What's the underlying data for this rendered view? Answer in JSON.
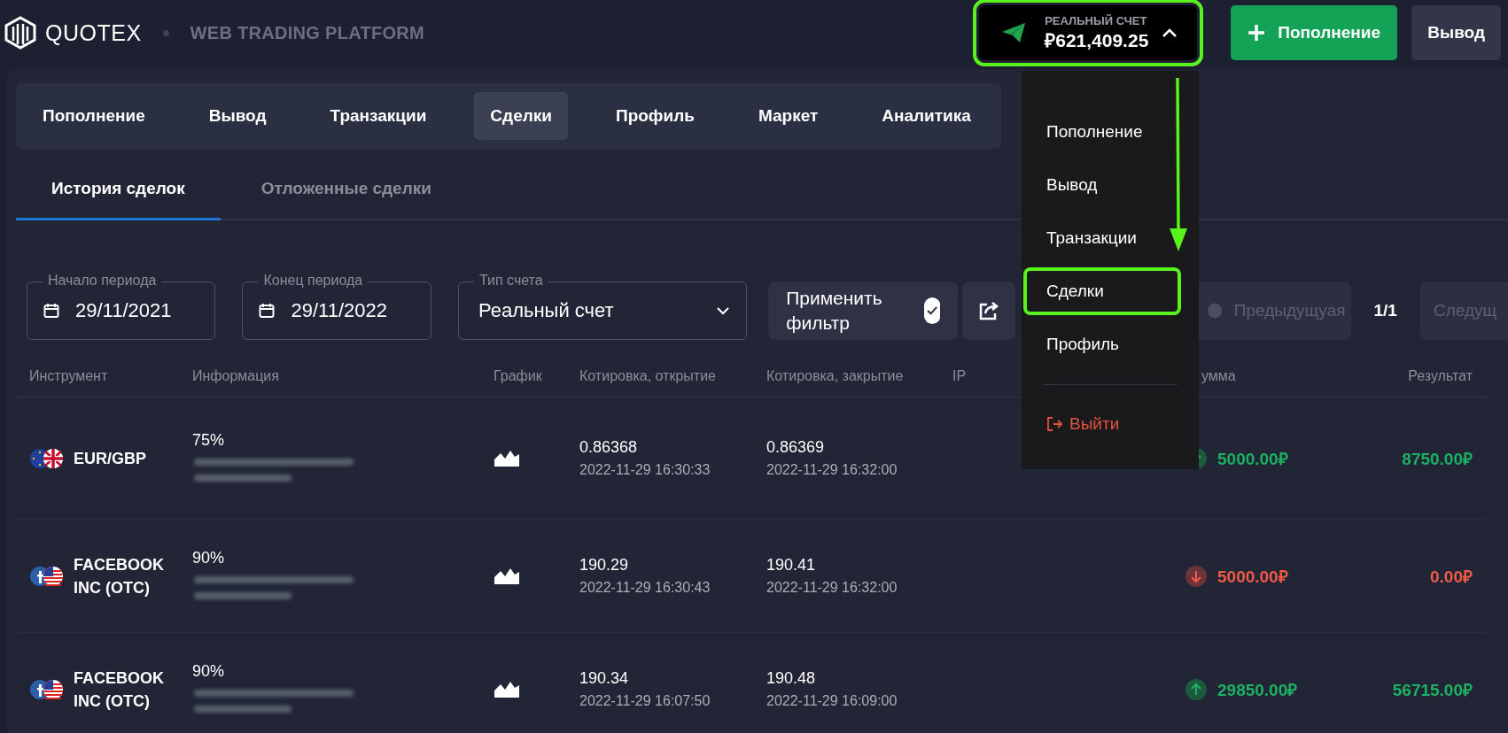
{
  "header": {
    "logo": "QUOTEX",
    "tagline": "WEB TRADING PLATFORM",
    "account": {
      "label": "РЕАЛЬНЫЙ СЧЕТ",
      "balance": "₽621,409.25",
      "expanded": true,
      "highlighted": true
    },
    "buttons": [
      {
        "label": "Пополнение",
        "kind": "primary"
      },
      {
        "label": "Вывод",
        "kind": "secondary"
      }
    ]
  },
  "account_menu": {
    "items": [
      {
        "label": "Пополнение",
        "highlighted": false
      },
      {
        "label": "Вывод",
        "highlighted": false
      },
      {
        "label": "Транзакции",
        "highlighted": false
      },
      {
        "label": "Сделки",
        "highlighted": true
      },
      {
        "label": "Профиль",
        "highlighted": false
      }
    ],
    "logout": "Выйти"
  },
  "nav_tabs": [
    {
      "label": "Пополнение",
      "selected": false
    },
    {
      "label": "Вывод",
      "selected": false
    },
    {
      "label": "Транзакции",
      "selected": false
    },
    {
      "label": "Сделки",
      "selected": true
    },
    {
      "label": "Профиль",
      "selected": false
    },
    {
      "label": "Маркет",
      "selected": false
    },
    {
      "label": "Аналитика",
      "selected": false
    }
  ],
  "sub_tabs": [
    {
      "label": "История сделок",
      "selected": true
    },
    {
      "label": "Отложенные сделки",
      "selected": false
    }
  ],
  "filters": {
    "start": {
      "label": "Начало периода",
      "value": "29/11/2021"
    },
    "end": {
      "label": "Конец периода",
      "value": "29/11/2022"
    },
    "account_type": {
      "label": "Тип счета",
      "value": "Реальный счет"
    },
    "apply": "Применить фильтр"
  },
  "pagination": {
    "previous": "Предыдущуая",
    "page": "1/1",
    "next": "Следущ"
  },
  "table": {
    "columns": [
      "Инструмент",
      "Информация",
      "График",
      "Котировка, открытие",
      "Котировка, закрытие",
      "IP",
      "умма",
      "Результат"
    ],
    "rows": [
      {
        "kind": "forex",
        "instrument": "EUR/GBP",
        "payout": "75%",
        "open_price": "0.86368",
        "open_time": "2022-11-29 16:30:33",
        "close_price": "0.86369",
        "close_time": "2022-11-29 16:32:00",
        "rising": true,
        "amount": "5000.00₽",
        "result": "8750.00₽",
        "profit": true
      },
      {
        "kind": "stock",
        "instrument": "FACEBOOK INC (OTC)",
        "payout": "90%",
        "open_price": "190.29",
        "open_time": "2022-11-29 16:30:43",
        "close_price": "190.41",
        "close_time": "2022-11-29 16:32:00",
        "rising": false,
        "amount": "5000.00₽",
        "result": "0.00₽",
        "profit": false
      },
      {
        "kind": "stock",
        "instrument": "FACEBOOK INC (OTC)",
        "payout": "90%",
        "open_price": "190.34",
        "open_time": "2022-11-29 16:07:50",
        "close_price": "190.48",
        "close_time": "2022-11-29 16:09:00",
        "rising": true,
        "amount": "29850.00₽",
        "result": "56715.00₽",
        "profit": true
      }
    ]
  }
}
